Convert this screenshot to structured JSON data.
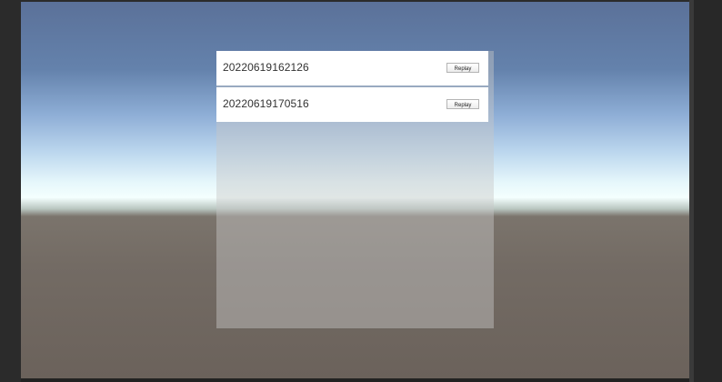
{
  "records": [
    {
      "name": "20220619162126",
      "button_label": "Replay"
    },
    {
      "name": "20220619170516",
      "button_label": "Replay"
    }
  ],
  "colors": {
    "panel_background": "rgba(200,200,200,0.45)",
    "item_background": "#ffffff",
    "sky_top": "#5b7199",
    "horizon": "#f4fffe",
    "ground": "#6b625b",
    "editor_background": "#2b2b2b"
  }
}
